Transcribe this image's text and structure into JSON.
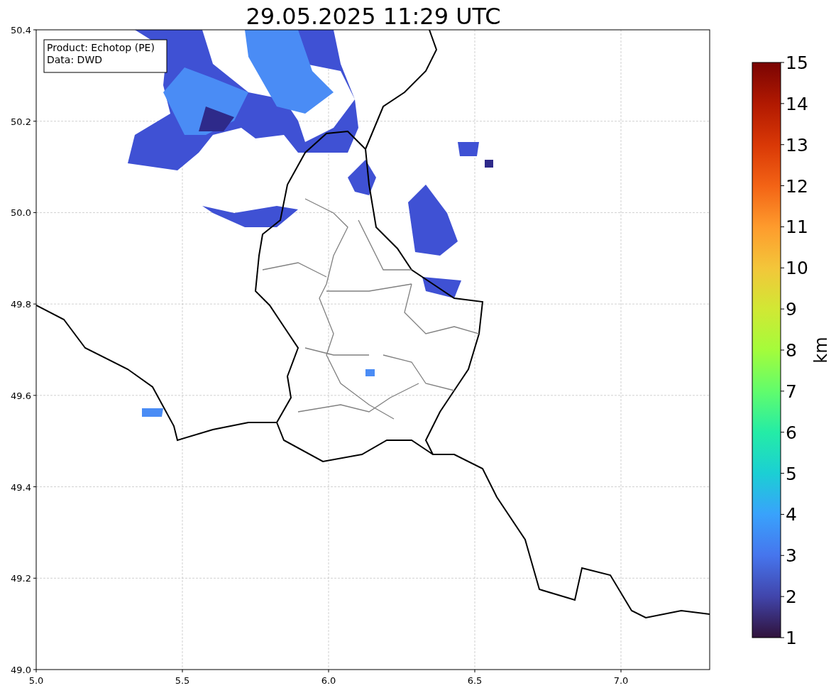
{
  "title": "29.05.2025 11:29 UTC",
  "info_box": [
    "Product: Echotop (PE)",
    "Data: DWD"
  ],
  "map": {
    "x_ticks": [
      "5.0",
      "5.5",
      "6.0",
      "6.5",
      "7.0"
    ],
    "y_ticks": [
      "50.4",
      "50.2",
      "50.0",
      "49.8",
      "49.6",
      "49.4",
      "49.2",
      "49.0"
    ]
  },
  "colorbar": {
    "label": "km",
    "ticks": [
      "15",
      "14",
      "13",
      "12",
      "11",
      "10",
      "9",
      "8",
      "7",
      "6",
      "5",
      "4",
      "3",
      "2",
      "1"
    ]
  }
}
